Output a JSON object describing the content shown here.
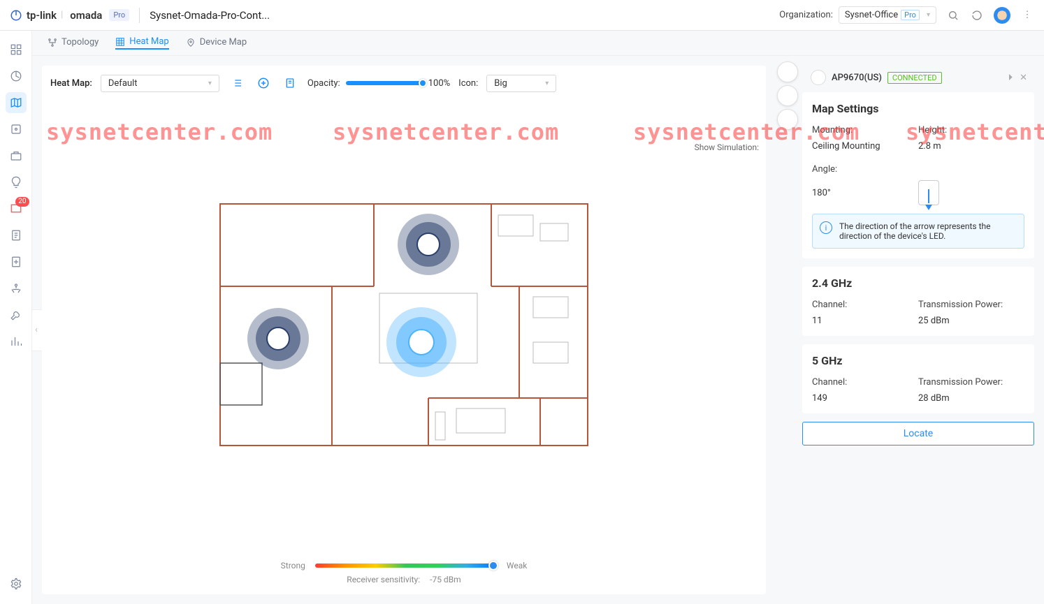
{
  "header": {
    "brand_tplink": "tp-link",
    "brand_omada": "omada",
    "brand_pro": "Pro",
    "site_name": "Sysnet-Omada-Pro-Cont...",
    "org_label": "Organization:",
    "org_value": "Sysnet-Office",
    "org_pro": "Pro"
  },
  "nav": {
    "badge": "20"
  },
  "tabs": {
    "topology": "Topology",
    "heatmap": "Heat Map",
    "devicemap": "Device Map"
  },
  "toolbar": {
    "heatmap_label": "Heat Map:",
    "heatmap_selected": "Default",
    "opacity_label": "Opacity:",
    "opacity_value": "100%",
    "icon_label": "Icon:",
    "icon_selected": "Big",
    "show_simulation": "Show Simulation:"
  },
  "legend": {
    "strong": "Strong",
    "sens_label": "Receiver sensitivity:",
    "sens_value": "-75 dBm",
    "weak": "Weak"
  },
  "panel": {
    "device_name": "AP9670(US)",
    "device_status": "CONNECTED",
    "map_settings_title": "Map Settings",
    "mounting_k": "Mounting:",
    "mounting_v": "Ceiling Mounting",
    "height_k": "Height:",
    "height_v": "2.8 m",
    "angle_k": "Angle:",
    "angle_v": "180°",
    "info_text": "The direction of the arrow represents the direction of the device's LED.",
    "g24_title": "2.4 GHz",
    "g24_channel_k": "Channel:",
    "g24_channel_v": "11",
    "g24_power_k": "Transmission Power:",
    "g24_power_v": "25 dBm",
    "g5_title": "5 GHz",
    "g5_channel_k": "Channel:",
    "g5_channel_v": "149",
    "g5_power_k": "Transmission Power:",
    "g5_power_v": "28 dBm",
    "locate_btn": "Locate"
  },
  "watermark": "sysnetcenter.com"
}
